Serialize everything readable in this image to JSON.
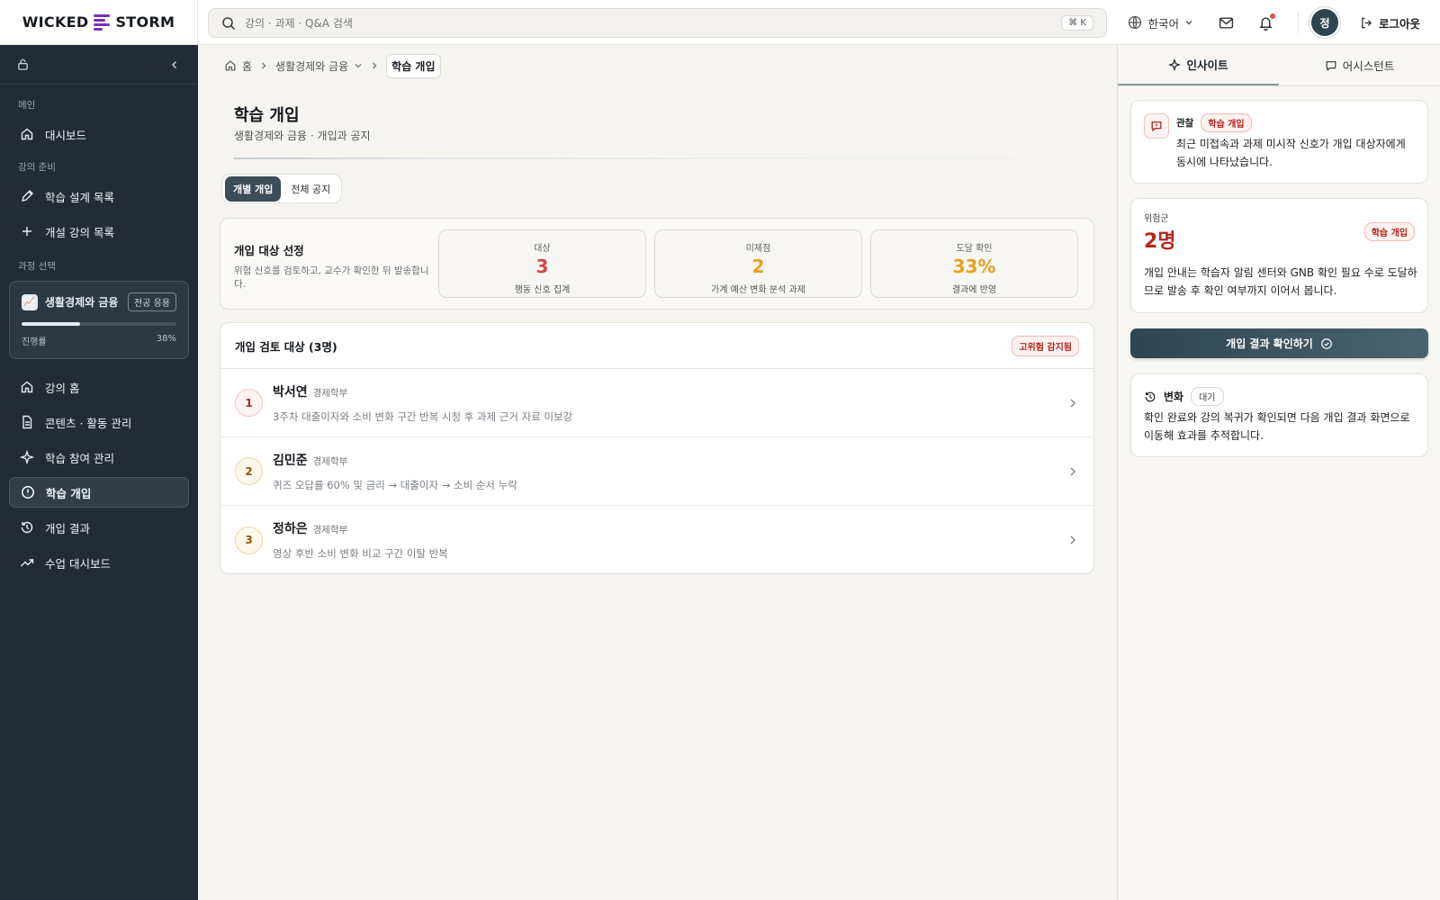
{
  "brand": {
    "wicked": "WICKED",
    "storm": "STORM"
  },
  "search": {
    "placeholder": "강의 · 과제 · Q&A 검색",
    "shortcut": "⌘ K"
  },
  "topbar": {
    "language": "한국어",
    "avatar_initial": "정",
    "logout": "로그아웃"
  },
  "sidebar": {
    "sections": {
      "main": "메인",
      "prep": "강의 준비",
      "course_select": "과정 선택"
    },
    "dashboard": "대시보드",
    "design_list": "학습 설계 목록",
    "open_course_list": "개설 강의 목록",
    "course": {
      "icon": "📈",
      "title": "생활경제와 금융",
      "badge": "전공 응용",
      "progress_label": "진행률",
      "progress_value": "38%",
      "progress_fraction": 0.38
    },
    "items": [
      {
        "label": "강의 홈",
        "icon": "home-icon"
      },
      {
        "label": "콘텐츠 · 활동 관리",
        "icon": "document-icon"
      },
      {
        "label": "학습 참여 관리",
        "icon": "sparkle-icon"
      },
      {
        "label": "학습 개입",
        "icon": "alert-circle-icon",
        "active": true
      },
      {
        "label": "개입 결과",
        "icon": "history-icon"
      },
      {
        "label": "수업 대시보드",
        "icon": "trend-icon"
      }
    ]
  },
  "breadcrumb": {
    "home": "홈",
    "course": "생활경제와 금융",
    "current": "학습 개입"
  },
  "page": {
    "title": "학습 개입",
    "subtitle": "생활경제와 금융 · 개입과 공지"
  },
  "tabs": {
    "individual": "개별 개입",
    "broadcast": "전체 공지"
  },
  "selection": {
    "title": "개입 대상 선정",
    "desc": "위험 신호를 검토하고, 교수가 확인한 뒤 발송합니다.",
    "stats": [
      {
        "label": "대상",
        "value": "3",
        "foot": "행동 신호 집계",
        "color": "#d64545"
      },
      {
        "label": "미제점",
        "value": "2",
        "foot": "가계 예산 변화 분석 과제",
        "color": "#e8a020"
      },
      {
        "label": "도달 확인",
        "value": "33%",
        "foot": "결과에 반영",
        "color": "#e8a020"
      }
    ]
  },
  "review": {
    "title": "개입 검토 대상 (3명)",
    "badge": "고위험 감지됨",
    "rows": [
      {
        "rank": "1",
        "name": "박서연",
        "dept": "경제학부",
        "desc": "3주차 대출이자와 소비 변화 구간 반복 시청 후 과제 근거 자료 미보강",
        "tone": "red"
      },
      {
        "rank": "2",
        "name": "김민준",
        "dept": "경제학부",
        "desc": "퀴즈 오답률 60% 및 금리 → 대출이자 → 소비 순서 누락",
        "tone": "amber"
      },
      {
        "rank": "3",
        "name": "정하은",
        "dept": "경제학부",
        "desc": "영상 후반 소비 변화 비교 구간 이탈 반복",
        "tone": "amber"
      }
    ]
  },
  "panel": {
    "tabs": {
      "insight": "인사이트",
      "assistant": "어시스턴트"
    },
    "observation": {
      "label": "관찰",
      "pill": "학습 개입",
      "text": "최근 미접속과 과제 미시작 신호가 개입 대상자에게 동시에 나타났습니다."
    },
    "risk": {
      "label": "위험군",
      "value": "2명",
      "pill": "학습 개입",
      "text": "개입 안내는 학습자 알림 센터와 GNB 확인 필요 수로 도달하므로 발송 후 확인 여부까지 이어서 봅니다."
    },
    "cta": "개입 결과 확인하기",
    "change": {
      "label": "변화",
      "pill": "대기",
      "text": "확인 완료와 강의 복귀가 확인되면 다음 개입 결과 화면으로 이동해 효과를 추적합니다."
    }
  }
}
